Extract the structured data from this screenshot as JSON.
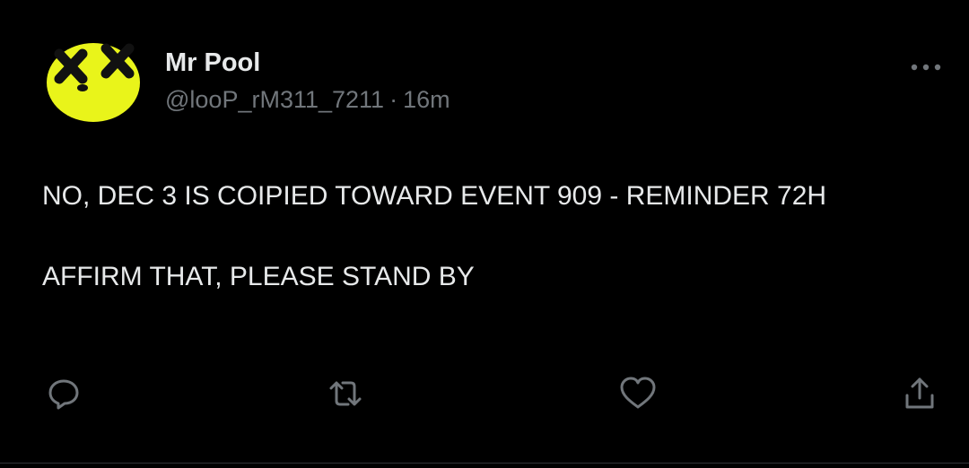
{
  "colors": {
    "background": "#000000",
    "primary_text": "#e7e9ea",
    "secondary_text": "#71767b",
    "icon": "#71767b",
    "avatar_yellow": "#e9f41a"
  },
  "tweet": {
    "display_name": "Mr Pool",
    "handle": "@looP_rM311_7211",
    "separator": "·",
    "time": "16m",
    "avatar_icon": "yellow-face-x-eyes-icon",
    "paragraphs": [
      "NO, DEC 3 IS COIPIED TOWARD EVENT 909 - REMINDER 72H",
      "AFFIRM THAT, PLEASE STAND BY"
    ]
  },
  "actions": {
    "more": "more-dots-icon",
    "reply": "reply-icon",
    "retweet": "retweet-icon",
    "like": "heart-icon",
    "share": "share-icon"
  }
}
